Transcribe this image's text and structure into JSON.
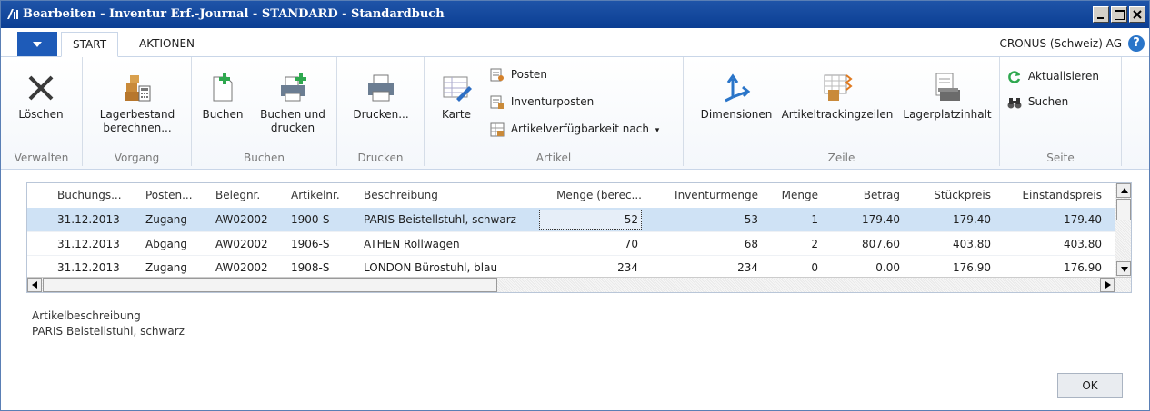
{
  "window": {
    "title": "Bearbeiten - Inventur Erf.-Journal - STANDARD - Standardbuch"
  },
  "tabs": [
    {
      "label": "START",
      "active": true
    },
    {
      "label": "AKTIONEN",
      "active": false
    }
  ],
  "company": "CRONUS (Schweiz) AG",
  "ribbon": {
    "groups": {
      "verwalten": "Verwalten",
      "vorgang": "Vorgang",
      "buchen": "Buchen",
      "drucken": "Drucken",
      "artikel": "Artikel",
      "zeile": "Zeile",
      "seite": "Seite"
    },
    "buttons": {
      "loeschen": "Löschen",
      "lagerbestand_1": "Lagerbestand",
      "lagerbestand_2": "berechnen...",
      "buchen": "Buchen",
      "buchen_drucken_1": "Buchen und",
      "buchen_drucken_2": "drucken",
      "drucken": "Drucken...",
      "karte": "Karte",
      "posten": "Posten",
      "inventurposten": "Inventurposten",
      "verfuegbarkeit": "Artikelverfügbarkeit nach",
      "dimensionen": "Dimensionen",
      "artikeltracking": "Artikeltrackingzeilen",
      "lagerplatz": "Lagerplatzinhalt",
      "aktualisieren": "Aktualisieren",
      "suchen": "Suchen"
    }
  },
  "grid": {
    "columns": [
      "Buchungs...",
      "Posten...",
      "Belegnr.",
      "Artikelnr.",
      "Beschreibung",
      "Menge (berec...",
      "Inventurmenge",
      "Menge",
      "Betrag",
      "Stückpreis",
      "Einstandspreis"
    ],
    "rows": [
      [
        "31.12.2013",
        "Zugang",
        "AW02002",
        "1900-S",
        "PARIS Beistellstuhl, schwarz",
        "52",
        "53",
        "1",
        "179.40",
        "179.40",
        "179.40"
      ],
      [
        "31.12.2013",
        "Abgang",
        "AW02002",
        "1906-S",
        "ATHEN Rollwagen",
        "70",
        "68",
        "2",
        "807.60",
        "403.80",
        "403.80"
      ],
      [
        "31.12.2013",
        "Zugang",
        "AW02002",
        "1908-S",
        "LONDON Bürostuhl, blau",
        "234",
        "234",
        "0",
        "0.00",
        "176.90",
        "176.90"
      ]
    ]
  },
  "details": {
    "label": "Artikelbeschreibung",
    "value": "PARIS Beistellstuhl, schwarz"
  },
  "ok_label": "OK"
}
